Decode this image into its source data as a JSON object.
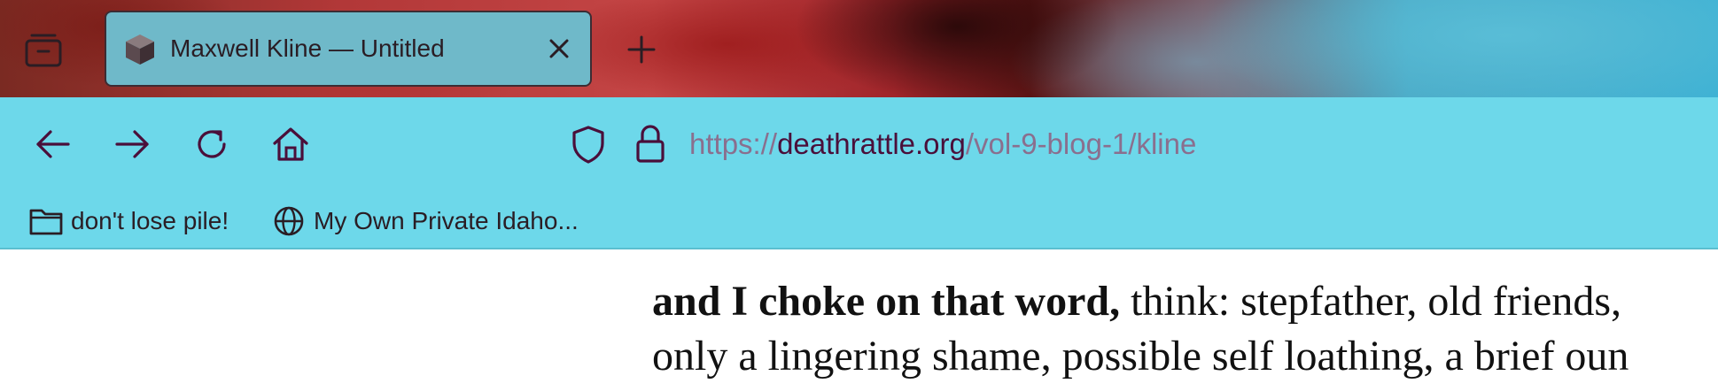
{
  "tab": {
    "title": "Maxwell Kline — Untitled",
    "favicon": "cube-icon"
  },
  "toolbar": {
    "back": "back-arrow-icon",
    "forward": "forward-arrow-icon",
    "reload": "reload-icon",
    "home": "home-icon"
  },
  "urlbar": {
    "scheme": "https://",
    "host": "deathrattle.org",
    "path": "/vol-9-blog-1/kline"
  },
  "bookmarks": [
    {
      "label": "don't lose pile!",
      "icon": "folder-icon"
    },
    {
      "label": "My Own Private Idaho...",
      "icon": "globe-icon"
    }
  ],
  "content": {
    "line1_bold": "and I choke on that word,",
    "line1_rest": " think: stepfather, old friends,",
    "line2": "only a lingering shame, possible self loathing, a brief oun"
  },
  "colors": {
    "toolbar_bg": "#6dd8ea",
    "icon_color": "#4a0f3a",
    "url_host": "#4a0f3a",
    "url_dim": "#8a6f8e"
  }
}
